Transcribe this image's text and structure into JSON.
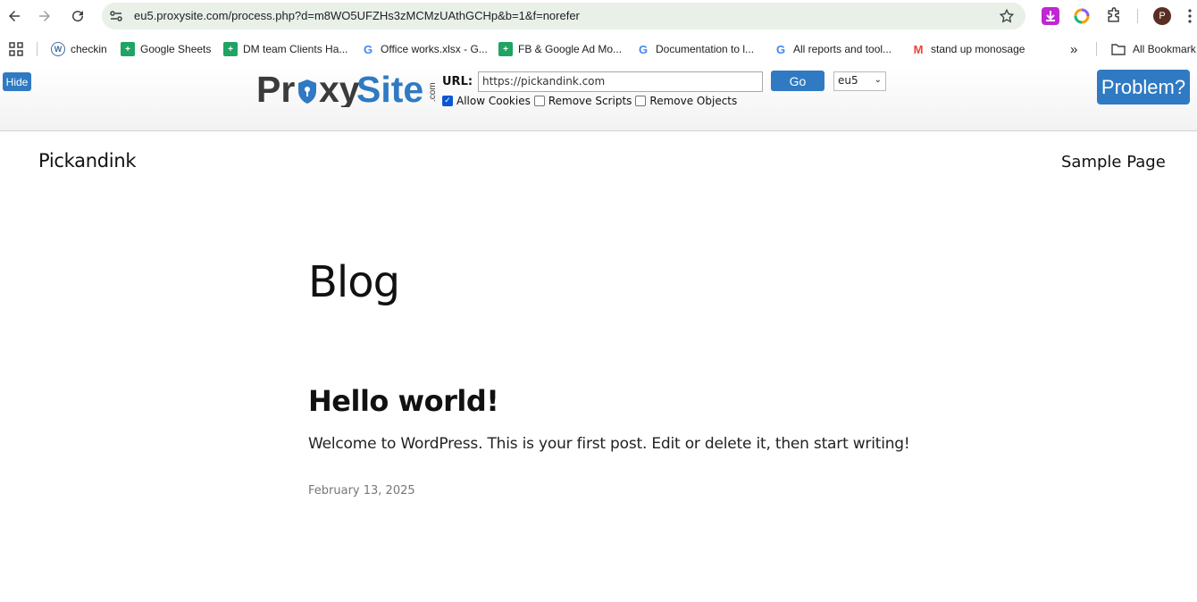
{
  "browser": {
    "url": "eu5.proxysite.com/process.php?d=m8WO5UFZHs3zMCMzUAthGCHp&b=1&f=norefer",
    "profile_initial": "P",
    "bookmarks": [
      {
        "label": "checkin",
        "icon": "wordpress-icon"
      },
      {
        "label": "Google Sheets",
        "icon": "sheets-icon"
      },
      {
        "label": "DM team Clients Ha...",
        "icon": "sheets-icon"
      },
      {
        "label": "Office works.xlsx - G...",
        "icon": "google-icon"
      },
      {
        "label": "FB & Google Ad Mo...",
        "icon": "sheets-icon"
      },
      {
        "label": "Documentation to l...",
        "icon": "google-icon"
      },
      {
        "label": "All reports and tool...",
        "icon": "google-icon"
      },
      {
        "label": "stand up monosage",
        "icon": "gmail-icon"
      }
    ],
    "all_bookmarks_label": "All Bookmark"
  },
  "proxy": {
    "hide_label": "Hide",
    "logo_proxy": "Pr xy",
    "logo_site": "Site",
    "logo_com": ".com",
    "url_label": "URL:",
    "url_value": "https://pickandink.com",
    "go_label": "Go",
    "server_value": "eu5",
    "options": [
      {
        "label": "Allow Cookies",
        "checked": true
      },
      {
        "label": "Remove Scripts",
        "checked": false
      },
      {
        "label": "Remove Objects",
        "checked": false
      }
    ],
    "problem_label": "Problem?"
  },
  "site": {
    "title": "Pickandink",
    "nav_link": "Sample Page",
    "heading": "Blog",
    "post": {
      "title": "Hello world!",
      "excerpt": "Welcome to WordPress. This is your first post. Edit or delete it, then start writing!",
      "date": "February 13, 2025"
    }
  },
  "colors": {
    "accent": "#2f7ac2",
    "omnibox_bg": "#e8f0e8"
  }
}
